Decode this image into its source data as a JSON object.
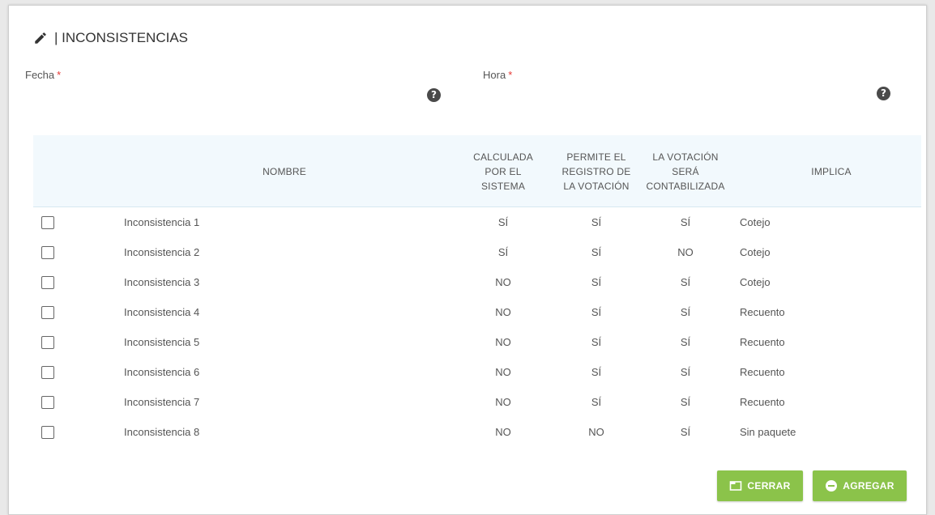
{
  "modal": {
    "title": "| INCONSISTENCIAS",
    "fecha_label": "Fecha",
    "hora_label": "Hora",
    "required_mark": "*",
    "help_glyph": "?"
  },
  "table": {
    "headers": {
      "nombre": "NOMBRE",
      "calculada": [
        "CALCULADA",
        "POR EL",
        "SISTEMA"
      ],
      "permite": [
        "PERMITE EL",
        "REGISTRO DE",
        "LA VOTACIÓN"
      ],
      "contabilizada": [
        "LA VOTACIÓN",
        "SERÁ",
        "CONTABILIZADA"
      ],
      "implica": "IMPLICA"
    },
    "rows": [
      {
        "nombre": "Inconsistencia 1",
        "calculada": "SÍ",
        "permite": "SÍ",
        "contabilizada": "SÍ",
        "implica": "Cotejo"
      },
      {
        "nombre": "Inconsistencia 2",
        "calculada": "SÍ",
        "permite": "SÍ",
        "contabilizada": "NO",
        "implica": "Cotejo"
      },
      {
        "nombre": "Inconsistencia 3",
        "calculada": "NO",
        "permite": "SÍ",
        "contabilizada": "SÍ",
        "implica": "Cotejo"
      },
      {
        "nombre": "Inconsistencia 4",
        "calculada": "NO",
        "permite": "SÍ",
        "contabilizada": "SÍ",
        "implica": "Recuento"
      },
      {
        "nombre": "Inconsistencia 5",
        "calculada": "NO",
        "permite": "SÍ",
        "contabilizada": "SÍ",
        "implica": "Recuento"
      },
      {
        "nombre": "Inconsistencia 6",
        "calculada": "NO",
        "permite": "SÍ",
        "contabilizada": "SÍ",
        "implica": "Recuento"
      },
      {
        "nombre": "Inconsistencia 7",
        "calculada": "NO",
        "permite": "SÍ",
        "contabilizada": "SÍ",
        "implica": "Recuento"
      },
      {
        "nombre": "Inconsistencia 8",
        "calculada": "NO",
        "permite": "NO",
        "contabilizada": "SÍ",
        "implica": "Sin paquete"
      }
    ]
  },
  "buttons": {
    "cerrar": "CERRAR",
    "agregar": "AGREGAR"
  },
  "colors": {
    "button_green": "#8bc34a",
    "required_red": "#e53935",
    "header_bg": "#f2f9fd"
  }
}
